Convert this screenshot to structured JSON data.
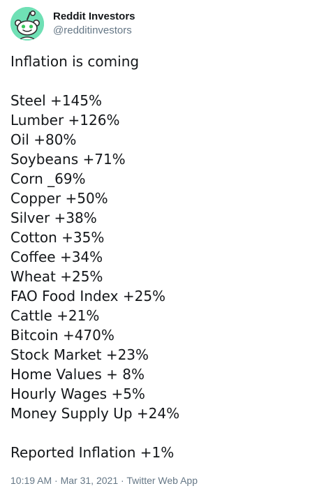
{
  "author": {
    "display_name": "Reddit Investors",
    "handle": "@redditinvestors",
    "avatar_icon": "reddit-alien-icon",
    "avatar_color": "#6fe0b5"
  },
  "tweet": {
    "headline": "Inflation is coming",
    "items": [
      "Steel +145%",
      "Lumber +126%",
      "Oil +80%",
      "Soybeans +71%",
      "Corn _69%",
      "Copper +50%",
      "Silver +38%",
      "Cotton +35%",
      "Coffee +34%",
      "Wheat +25%",
      "FAO Food Index +25%",
      "Cattle +21%",
      "Bitcoin +470%",
      "Stock Market +23%",
      "Home Values + 8%",
      "Hourly Wages +5%",
      "Money Supply Up +24%"
    ],
    "footer_line": "Reported Inflation +1%"
  },
  "meta": {
    "time": "10:19 AM",
    "separator": "·",
    "date": "Mar 31, 2021",
    "source": "Twitter Web App"
  },
  "colors": {
    "text": "#14171a",
    "secondary": "#657786",
    "background": "#ffffff"
  }
}
